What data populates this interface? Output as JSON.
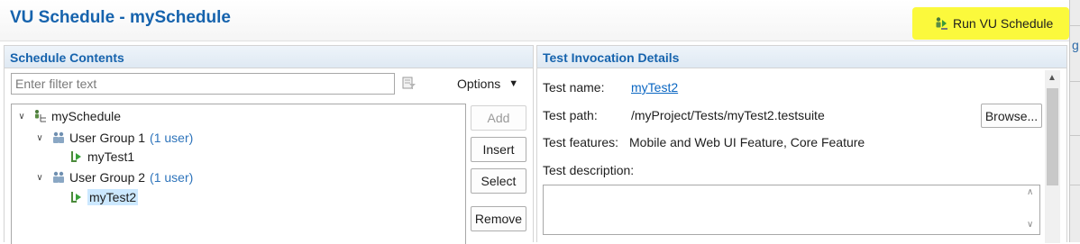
{
  "header": {
    "title": "VU Schedule - mySchedule",
    "run_button": "Run VU Schedule",
    "accent_color": "#1663ad",
    "highlight_color": "#fbf93c"
  },
  "side_strip": {
    "letter": "g"
  },
  "schedule_contents": {
    "title": "Schedule Contents",
    "filter_placeholder": "Enter filter text",
    "options_label": "Options",
    "tree": {
      "root": "mySchedule",
      "groups": [
        {
          "label": "User Group 1",
          "count": "(1 user)",
          "test": "myTest1"
        },
        {
          "label": "User Group 2",
          "count": "(1 user)",
          "test": "myTest2"
        }
      ],
      "selected": "myTest2"
    },
    "buttons": {
      "add": "Add",
      "insert": "Insert",
      "select": "Select",
      "remove": "Remove"
    }
  },
  "test_invocation": {
    "title": "Test Invocation Details",
    "name_label": "Test name:",
    "name_value": "myTest2",
    "path_label": "Test path:",
    "path_value": "/myProject/Tests/myTest2.testsuite",
    "browse_button": "Browse...",
    "features_label": "Test features:",
    "features_value": "Mobile and Web UI Feature, Core Feature",
    "description_label": "Test description:",
    "description_value": ""
  }
}
